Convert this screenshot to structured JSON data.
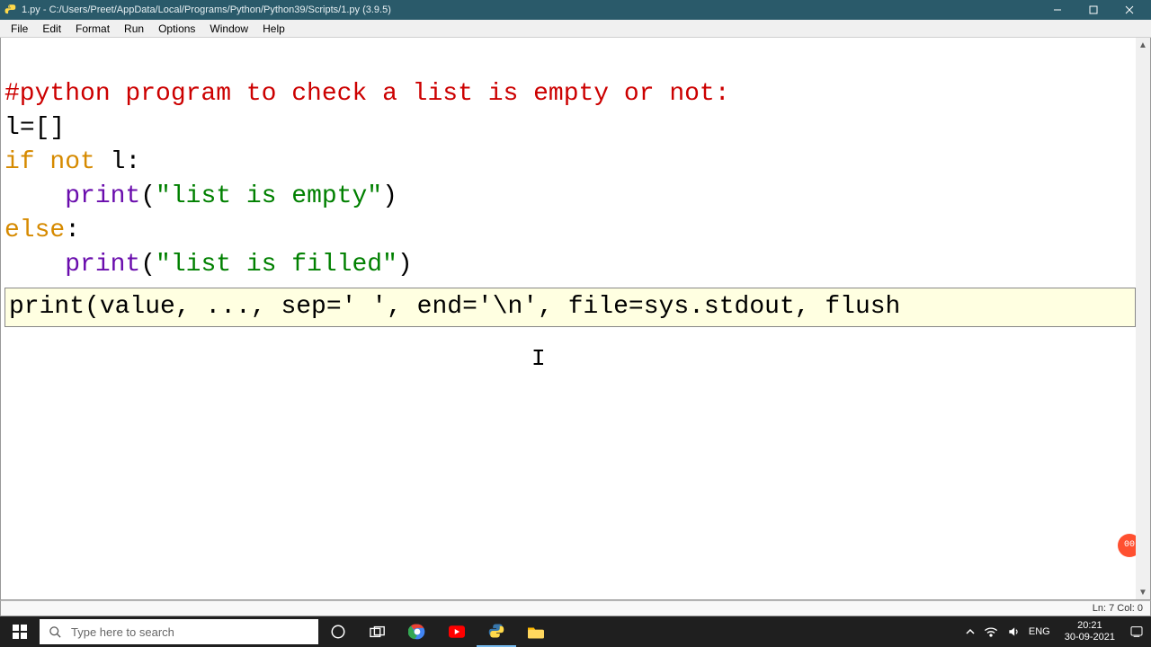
{
  "window": {
    "title": "1.py - C:/Users/Preet/AppData/Local/Programs/Python/Python39/Scripts/1.py (3.9.5)"
  },
  "menu": {
    "items": [
      "File",
      "Edit",
      "Format",
      "Run",
      "Options",
      "Window",
      "Help"
    ]
  },
  "code": {
    "line1_comment": "#python program to check a list is empty or not:",
    "line2_name": "l",
    "line2_rest": "=[]",
    "line3_kw1": "if",
    "line3_kw2": "not",
    "line3_name": " l",
    "line3_colon": ":",
    "line4_indent": "    ",
    "line4_builtin": "print",
    "line4_paren_open": "(",
    "line4_str": "\"list is empty\"",
    "line4_paren_close": ")",
    "line5_kw": "else",
    "line5_colon": ":",
    "line6_indent": "    ",
    "line6_builtin": "print",
    "line6_paren_open": "(",
    "line6_str": "\"list is filled\"",
    "line6_paren_close": ")"
  },
  "calltip": {
    "text": "print(value, ..., sep=' ', end='\\n', file=sys.stdout, flush"
  },
  "status": {
    "position": "Ln: 7  Col: 0"
  },
  "taskbar": {
    "search_placeholder": "Type here to search",
    "lang": "ENG",
    "time": "20:21",
    "date": "30-09-2021"
  },
  "badge": {
    "text": "00"
  }
}
